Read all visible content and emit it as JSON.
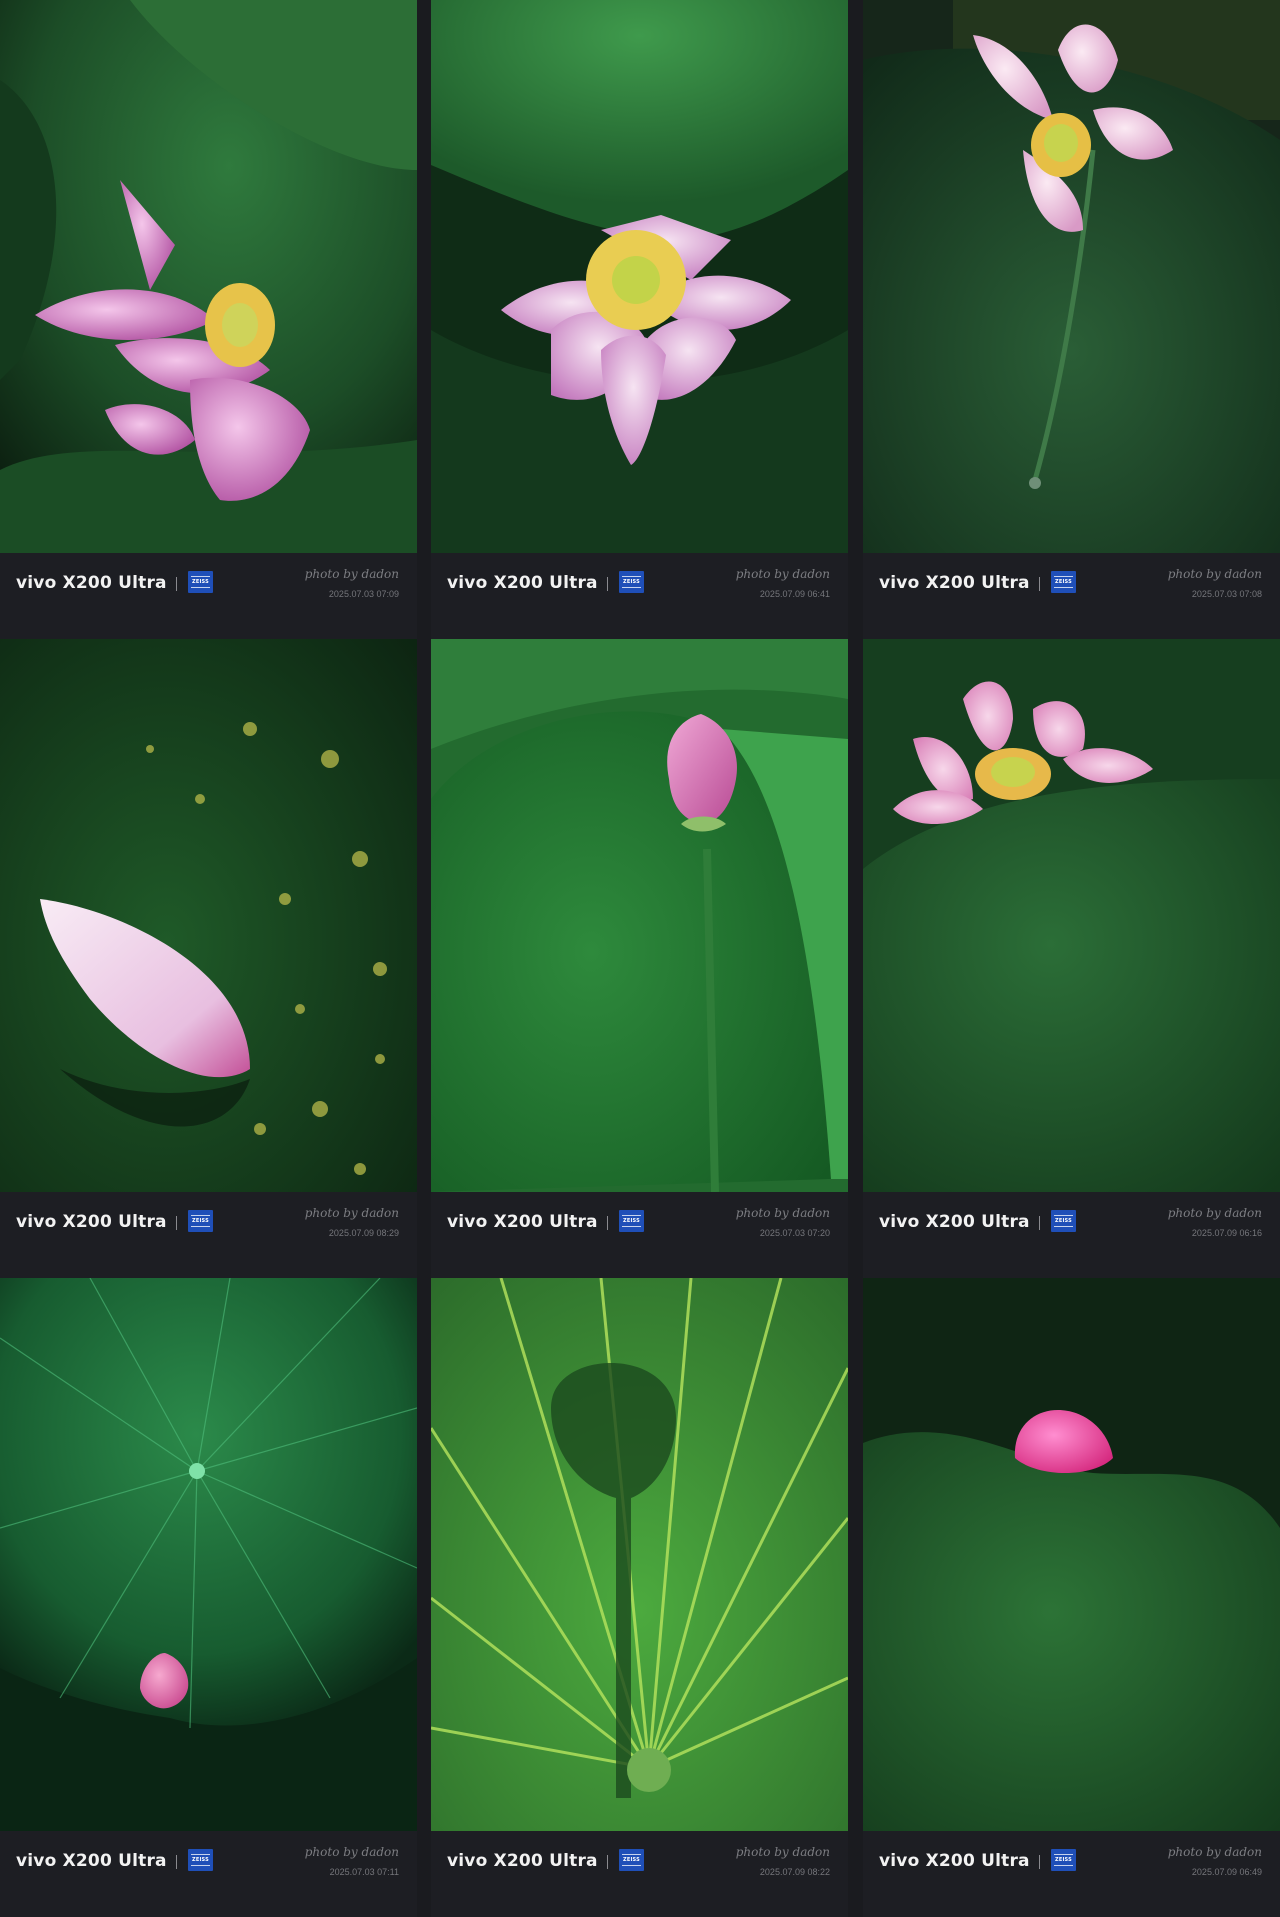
{
  "colors": {
    "page_background": "#1a1b1f",
    "footer_background": "#1d1e23",
    "brand_text": "#f2f2f2",
    "zeiss_blue": "#1f4fb8",
    "meta_text": "#7c7d82"
  },
  "zeiss_label": "ZEISS",
  "photos": [
    {
      "brand": "vivo X200 Ultra",
      "credit": "photo by dadon",
      "date": "2025.07.03 07:09",
      "subject": "pink lotus flower against large lotus leaves"
    },
    {
      "brand": "vivo X200 Ultra",
      "credit": "photo by dadon",
      "date": "2025.07.09 06:41",
      "subject": "open pink lotus under a leaf"
    },
    {
      "brand": "vivo X200 Ultra",
      "credit": "photo by dadon",
      "date": "2025.07.03 07:08",
      "subject": "pale pink lotus above a dark leaf"
    },
    {
      "brand": "vivo X200 Ultra",
      "credit": "photo by dadon",
      "date": "2025.07.09 08:29",
      "subject": "fallen lotus petal on spotted leaf"
    },
    {
      "brand": "vivo X200 Ultra",
      "credit": "photo by dadon",
      "date": "2025.07.03 07:20",
      "subject": "lotus bud in front of curled leaf"
    },
    {
      "brand": "vivo X200 Ultra",
      "credit": "photo by dadon",
      "date": "2025.07.09 06:16",
      "subject": "pink lotus behind a leaf edge"
    },
    {
      "brand": "vivo X200 Ultra",
      "credit": "photo by dadon",
      "date": "2025.07.03 07:11",
      "subject": "radiating lotus leaf with small bud"
    },
    {
      "brand": "vivo X200 Ultra",
      "credit": "photo by dadon",
      "date": "2025.07.09 08:22",
      "subject": "backlit lotus leaf veins with shadow"
    },
    {
      "brand": "vivo X200 Ultra",
      "credit": "photo by dadon",
      "date": "2025.07.09 06:49",
      "subject": "deep pink lotus bud above a leaf"
    }
  ]
}
